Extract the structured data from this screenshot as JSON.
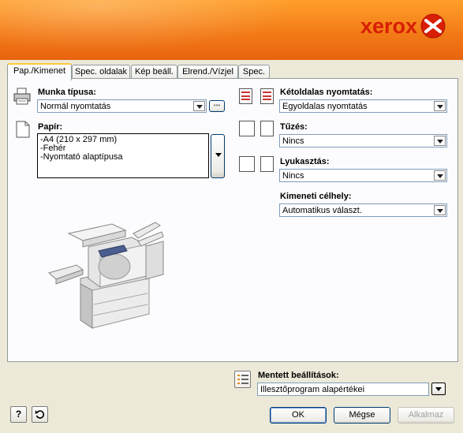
{
  "header": {
    "brand": "xerox"
  },
  "tabs": [
    {
      "label": "Pap./Kimenet"
    },
    {
      "label": "Spec. oldalak"
    },
    {
      "label": "Kép beáll."
    },
    {
      "label": "Elrend./Vízjel"
    },
    {
      "label": "Spec."
    }
  ],
  "job_type": {
    "label": "Munka típusa:",
    "value": "Normál nyomtatás",
    "more": "•••"
  },
  "paper": {
    "label": "Papír:",
    "lines": [
      "-A4 (210 x 297 mm)",
      "-Fehér",
      "-Nyomtató alaptípusa"
    ]
  },
  "duplex": {
    "label": "Kétoldalas nyomtatás:",
    "value": "Egyoldalas nyomtatás"
  },
  "stapling": {
    "label": "Tűzés:",
    "value": "Nincs"
  },
  "punching": {
    "label": "Lyukasztás:",
    "value": "Nincs"
  },
  "output": {
    "label": "Kimeneti célhely:",
    "value": "Automatikus választ."
  },
  "saved": {
    "label": "Mentett beállítások:",
    "value": "Illesztőprogram alapértékei"
  },
  "footer": {
    "help": "?",
    "ok": "OK",
    "cancel": "Mégse",
    "apply": "Alkalmaz"
  },
  "colors": {
    "accent_orange": "#f37b17",
    "brand_red": "#d81e05",
    "tab_highlight": "#ffc83c"
  }
}
